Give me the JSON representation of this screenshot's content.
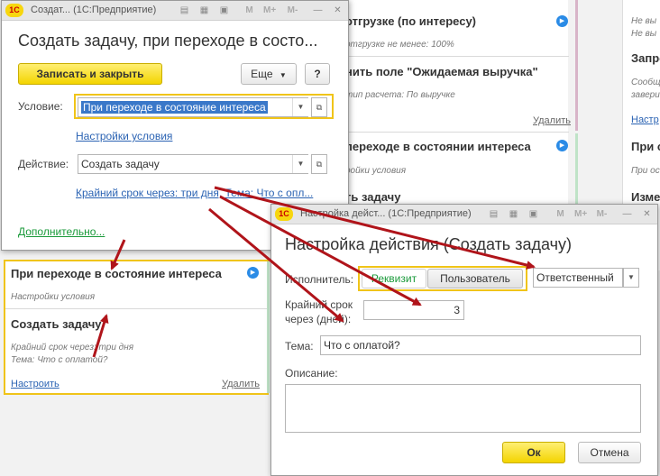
{
  "bg": {
    "top_title": "отгрузке (по интересу)",
    "top_sub": "отгрузке не менее: 100%",
    "item2_title": "нить поле \"Ожидаемая выручка\"",
    "item2_sub": "тип расчета: По выручке",
    "item2_delete": "Удалить",
    "item3_title": "переходе в состоянии интереса",
    "item3_sub": "ройки условия",
    "item4_title": "ть задачу",
    "right_line1": "Не вы",
    "right_line2": "Не вы",
    "right_title1": "Запро",
    "right_line3": "Сообщ",
    "right_line4": "завери",
    "right_link1": "Настр",
    "right_title2": "При с",
    "right_line5": "При ос",
    "right_title3": "Измен"
  },
  "win1": {
    "title": "Создат... (1С:Предприятие)",
    "header": "Создать задачу, при переходе в состо...",
    "save_close_label": "Записать и закрыть",
    "more_label": "Еще",
    "help_label": "?",
    "condition_label": "Условие:",
    "condition_value": "При переходе в состояние интереса",
    "condition_settings_link": "Настройки условия",
    "action_label": "Действие:",
    "action_value": "Создать задачу",
    "action_params_link": "Крайний срок через: три дня, Тема: Что с опл...",
    "additional_link": "Дополнительно..."
  },
  "card": {
    "title": "При переходе в состояние интереса",
    "subtitle": "Настройки условия",
    "action_title": "Создать задачу",
    "detail1": "Крайний срок через: три дня",
    "detail2": "Тема: Что с оплатой?",
    "configure_link": "Настроить",
    "delete_link": "Удалить"
  },
  "win2": {
    "title": "Настройка дейст... (1С:Предприятие)",
    "header": "Настройка действия (Создать задачу)",
    "executor_label": "Исполнитель:",
    "toggle_attr": "Реквизит",
    "toggle_user": "Пользователь",
    "executor_value": "Ответственный",
    "deadline_label_1": "Крайний срок",
    "deadline_label_2": "через (дней):",
    "deadline_value": "3",
    "topic_label": "Тема:",
    "topic_value": "Что с оплатой?",
    "description_label": "Описание:",
    "ok_label": "Ок",
    "cancel_label": "Отмена"
  },
  "colors": {
    "accent_yellow": "#f3d400",
    "link_blue": "#2b63b3",
    "arrow_red": "#b0141a",
    "green_link": "#1a9a3a"
  }
}
